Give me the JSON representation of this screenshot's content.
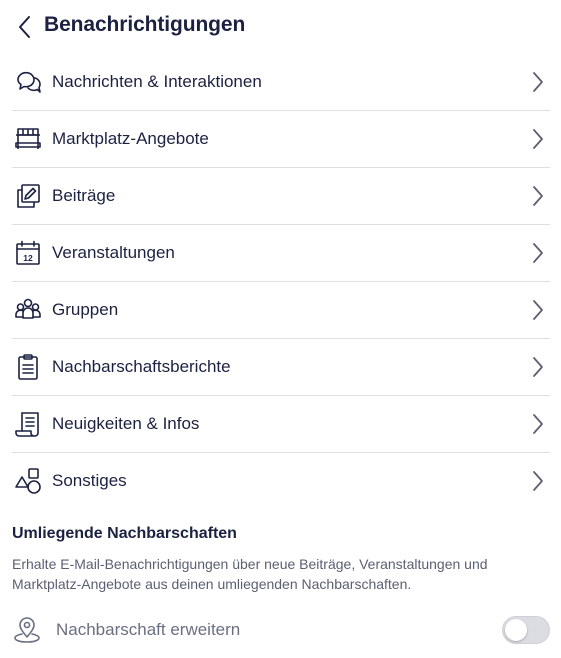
{
  "header": {
    "title": "Benachrichtigungen",
    "back_icon": "chevron-left-icon"
  },
  "menu": {
    "items": [
      {
        "label": "Nachrichten & Interaktionen",
        "icon": "chat-bubbles-icon"
      },
      {
        "label": "Marktplatz-Angebote",
        "icon": "market-stall-icon"
      },
      {
        "label": "Beiträge",
        "icon": "edit-post-icon"
      },
      {
        "label": "Veranstaltungen",
        "icon": "calendar-icon",
        "icon_text": "12"
      },
      {
        "label": "Gruppen",
        "icon": "group-icon"
      },
      {
        "label": "Nachbarschaftsberichte",
        "icon": "clipboard-icon"
      },
      {
        "label": "Neuigkeiten & Infos",
        "icon": "newspaper-icon"
      },
      {
        "label": "Sonstiges",
        "icon": "shapes-icon"
      }
    ]
  },
  "nearby": {
    "title": "Umliegende Nachbarschaften",
    "description": "Erhalte E-Mail-Benachrichtigungen über neue Beiträge, Veranstaltungen und Marktplatz-Angebote aus deinen umliegenden Nachbarschaften.",
    "toggle_label": "Nachbarschaft erweitern",
    "toggle_on": false,
    "toggle_icon": "map-pin-icon"
  },
  "colors": {
    "text": "#1c2141",
    "muted": "#5b5f72",
    "divider": "#dedfe4",
    "toggle_off": "#dcdde3"
  }
}
